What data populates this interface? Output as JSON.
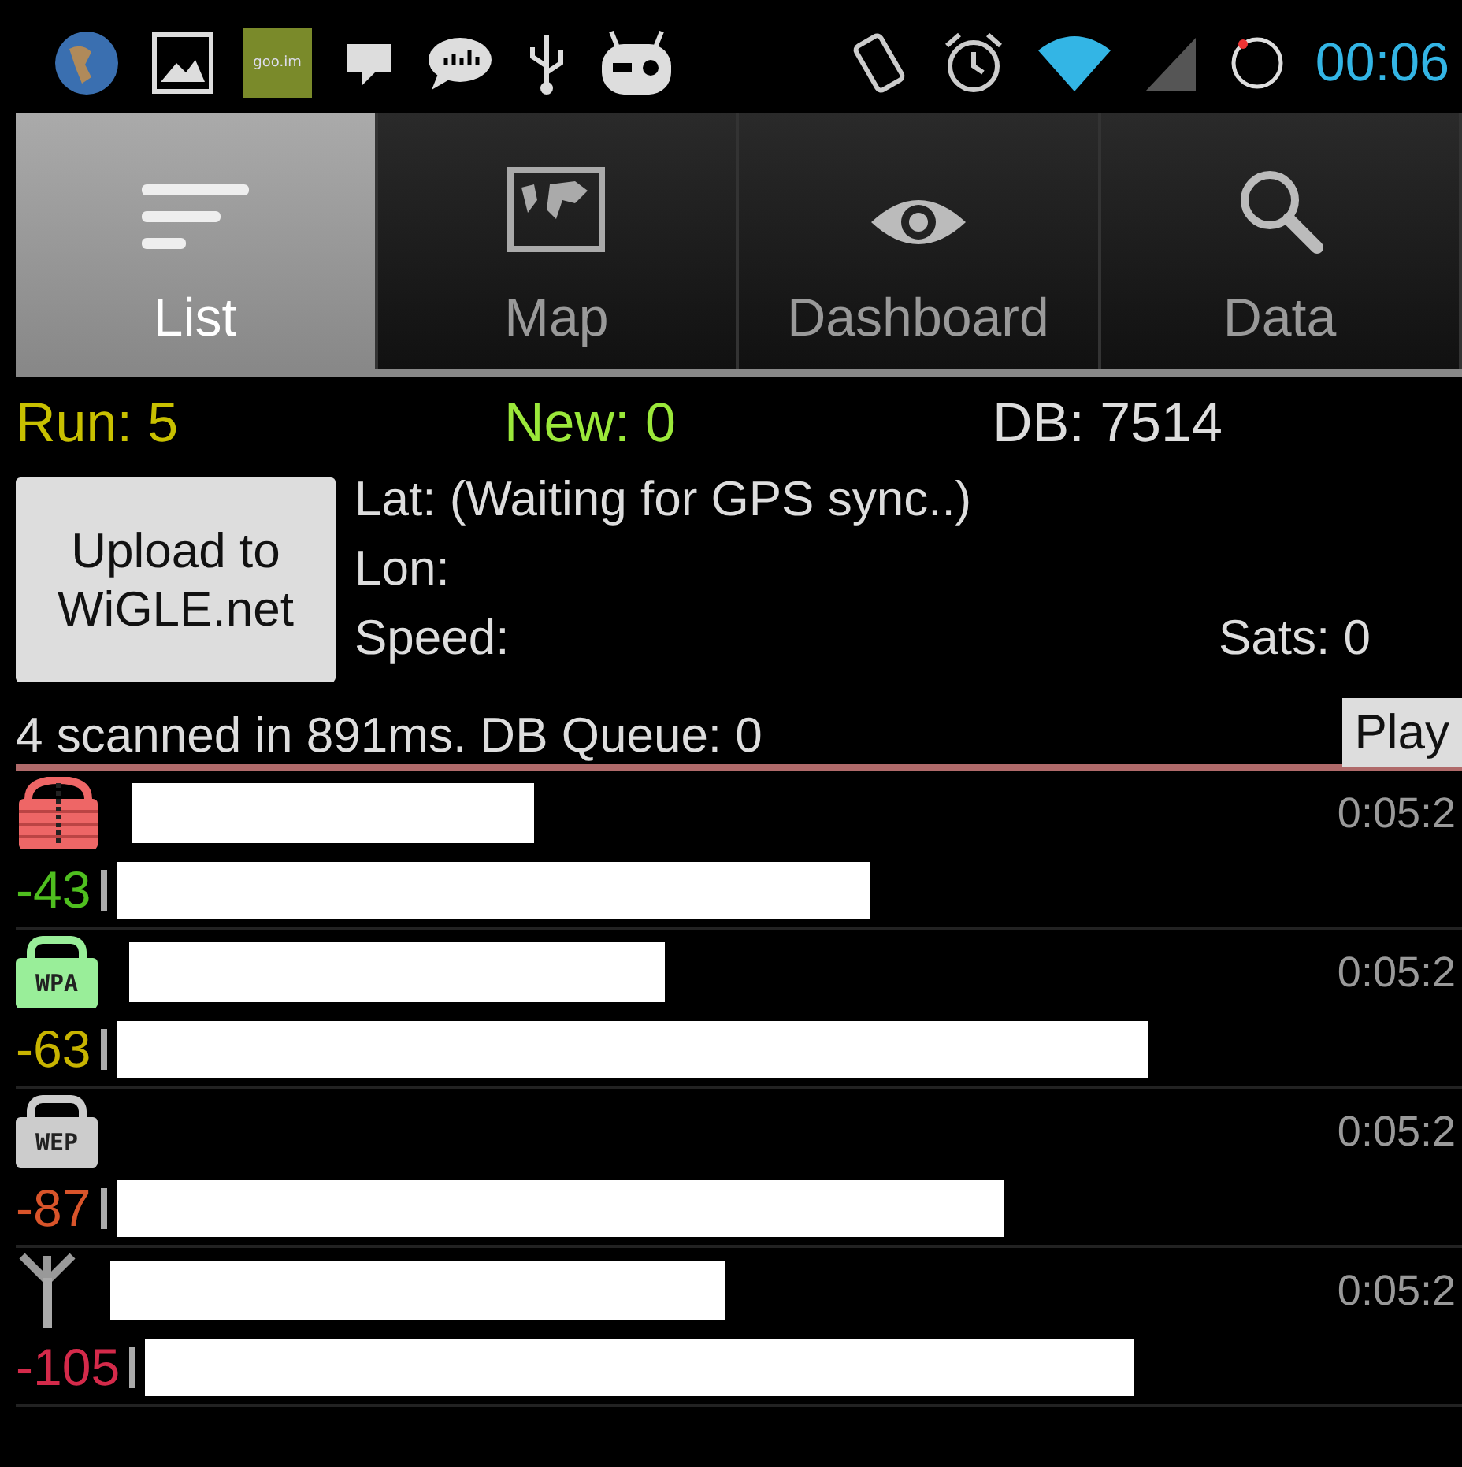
{
  "status_bar": {
    "badge_text": "goo.im",
    "time": "00:06"
  },
  "tabs": [
    {
      "label": "List",
      "kind": "list",
      "selected": true
    },
    {
      "label": "Map",
      "kind": "map",
      "selected": false
    },
    {
      "label": "Dashboard",
      "kind": "eye",
      "selected": false
    },
    {
      "label": "Data",
      "kind": "search",
      "selected": false
    }
  ],
  "stats": {
    "run": "Run: 5",
    "new": "New: 0",
    "db": "DB: 7514"
  },
  "upload_button": "Upload to WiGLE.net",
  "gps": {
    "lat": "Lat: (Waiting for GPS sync..)",
    "lon": "Lon:",
    "speed": "Speed:",
    "sats": "Sats: 0"
  },
  "scan_status": "4 scanned in 891ms. DB Queue: 0",
  "play_button": "Play",
  "networks": [
    {
      "kind": "open",
      "signal": "-43",
      "color": "#4fbf1f",
      "time": "0:05:2"
    },
    {
      "kind": "wpa",
      "icon_label": "WPA",
      "signal": "-63",
      "color": "#c8b400",
      "time": "0:05:2"
    },
    {
      "kind": "wep",
      "icon_label": "WEP",
      "signal": "-87",
      "color": "#d9542a",
      "time": "0:05:2"
    },
    {
      "kind": "cell",
      "signal": "-105",
      "color": "#d42a4a",
      "time": "0:05:2"
    }
  ]
}
